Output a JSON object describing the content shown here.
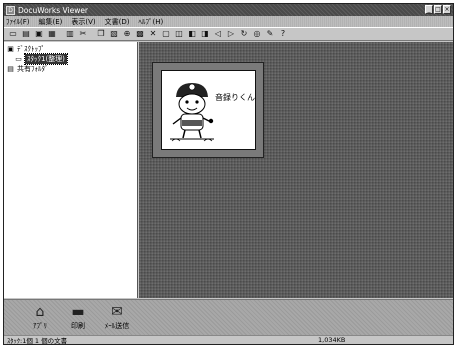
{
  "window": {
    "title": "DocuWorks Viewer",
    "buttons": {
      "minimize": "_",
      "maximize": "□",
      "close": "×"
    }
  },
  "menu": [
    "ﾌｧｲﾙ(F)",
    "編集(E)",
    "表示(V)",
    "文書(D)",
    "ﾍﾙﾌﾟ(H)"
  ],
  "toolbar": {
    "icons": [
      "new-icon",
      "open-icon",
      "save-icon",
      "print-icon",
      "scan-icon",
      "cut-icon",
      "copy-icon",
      "paste-icon",
      "zoom-icon",
      "view-icon",
      "delete-icon",
      "page-icon",
      "pages-icon",
      "bind-icon",
      "unbind-icon",
      "prev-icon",
      "next-icon",
      "rotate-icon",
      "find-icon",
      "annotate-icon",
      "help-icon"
    ]
  },
  "tree": {
    "items": [
      {
        "label": "ﾃﾞｽｸﾄｯﾌﾟ",
        "icon": "desktop-icon"
      },
      {
        "label": "ｽﾀｯｸ1(整理)",
        "icon": "folder-icon",
        "selected": true
      },
      {
        "label": "共有ﾌｫﾙﾀﾞ",
        "icon": "shared-folder-icon"
      }
    ]
  },
  "document": {
    "title": "音録りくん"
  },
  "actions": [
    {
      "label": "ｱﾌﾟﾘ",
      "icon": "app-icon"
    },
    {
      "label": "印刷",
      "icon": "printer-icon"
    },
    {
      "label": "ﾒｰﾙ送信",
      "icon": "mail-icon"
    }
  ],
  "status": {
    "left": "ｽﾀｯｸ:1個 1 個の文書",
    "right": "1,034KB"
  }
}
